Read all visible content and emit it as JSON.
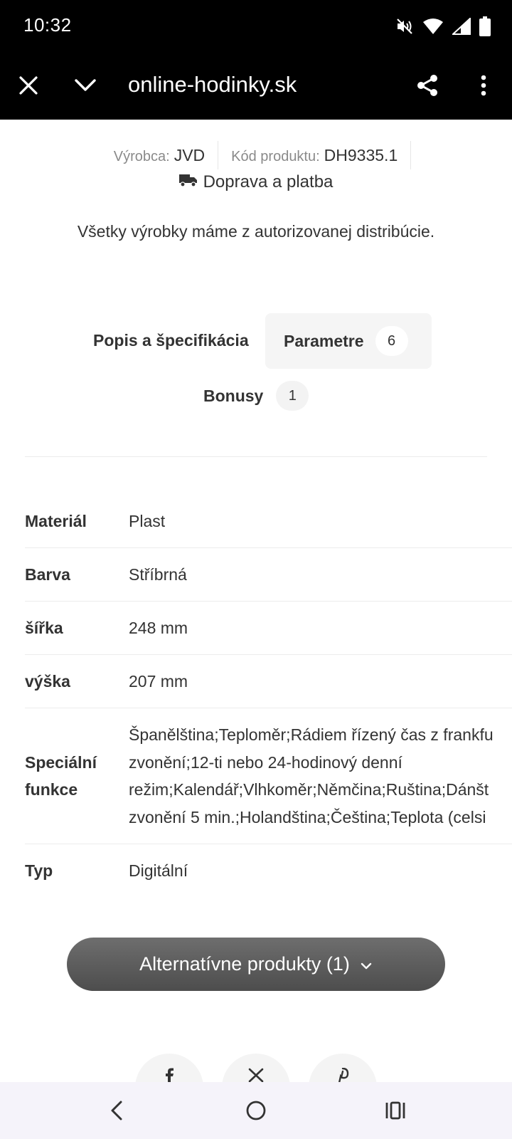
{
  "status_bar": {
    "time": "10:32",
    "icons": [
      "mute-icon",
      "wifi-icon",
      "signal-icon",
      "battery-icon"
    ]
  },
  "toolbar": {
    "url": "online-hodinky.sk",
    "icons": [
      "close-icon",
      "chevron-down-icon",
      "share-icon",
      "more-vert-icon"
    ]
  },
  "product": {
    "manufacturer_label": "Výrobca:",
    "manufacturer": "JVD",
    "code_label": "Kód produktu:",
    "code": "DH9335.1",
    "shipping_label": "Doprava a platba",
    "authorized_text": "Všetky výrobky máme z autorizovanej distribúcie."
  },
  "tabs": [
    {
      "label": "Popis a špecifikácia",
      "count": ""
    },
    {
      "label": "Parametre",
      "count": "6",
      "active": true
    },
    {
      "label": "Bonusy",
      "count": "1"
    }
  ],
  "parameters": [
    {
      "name": "Materiál",
      "value": "Plast"
    },
    {
      "name": "Barva",
      "value": "Stříbrná"
    },
    {
      "name": "šířka",
      "value": "248 mm"
    },
    {
      "name": "výška",
      "value": "207 mm"
    },
    {
      "name": "Speciální funkce",
      "value_lines": [
        "Španělština;Teploměr;Rádiem řízený čas z frankfu",
        "zvonění;12-ti nebo 24-hodinový denní",
        "režim;Kalendář;Vlhkoměr;Němčina;Ruština;Dánšt",
        "zvonění 5 min.;Holandština;Čeština;Teplota (celsi"
      ]
    },
    {
      "name": "Typ",
      "value": "Digitální"
    }
  ],
  "alternative_button": "Alternatívne produkty (1)",
  "share_icons": [
    "facebook-icon",
    "x-icon",
    "pinterest-icon"
  ],
  "nav_bar": [
    "back-icon",
    "home-icon",
    "recents-icon"
  ],
  "colors": {
    "toolbar_bg": "#000000",
    "button_bg": "#5a5a5a",
    "tab_active_bg": "#f5f5f5",
    "nav_bg": "#f5f3fa"
  }
}
